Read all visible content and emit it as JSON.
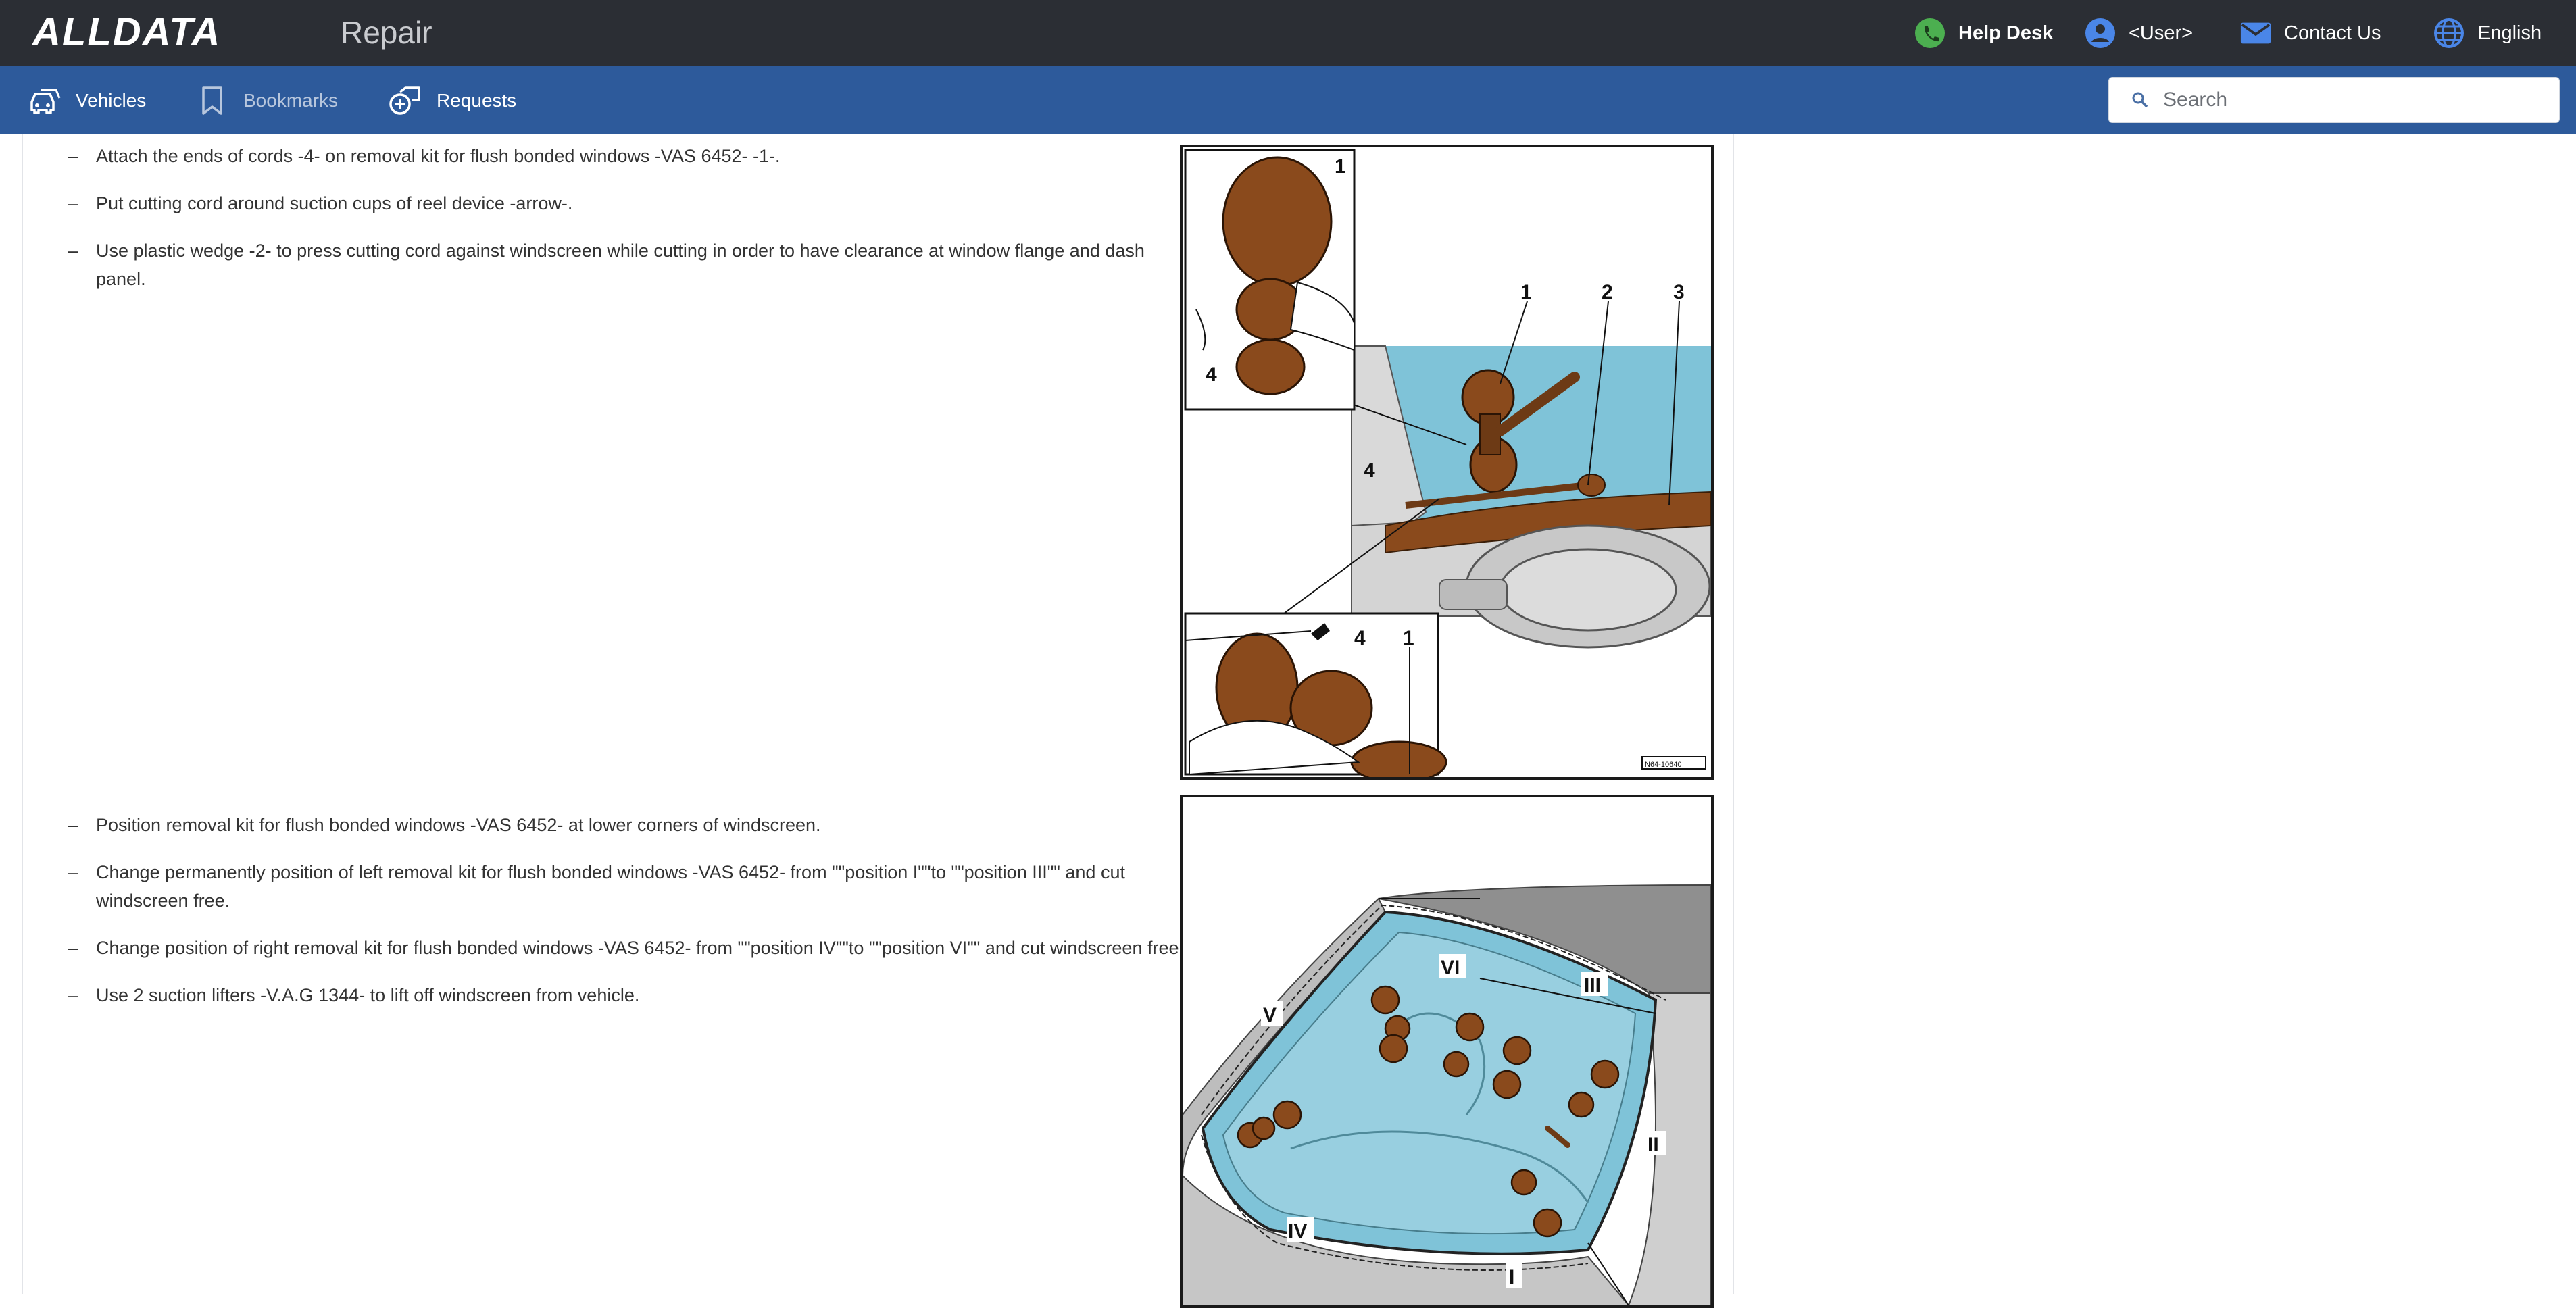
{
  "header": {
    "brand": "ALLDATA",
    "section": "Repair",
    "help_desk": "Help Desk",
    "user": "<User>",
    "contact": "Contact Us",
    "language": "English"
  },
  "nav": {
    "vehicles": "Vehicles",
    "bookmarks": "Bookmarks",
    "requests": "Requests"
  },
  "search": {
    "placeholder": "Search",
    "value": ""
  },
  "section1": {
    "steps": [
      "Attach the ends of cords -4- on removal kit for flush bonded windows -VAS 6452- -1-.",
      "Put cutting cord around suction cups of reel device -arrow-.",
      "Use plastic wedge -2- to press cutting cord against windscreen while cutting in order to have clearance at window flange and dash panel."
    ],
    "figure": {
      "labels": [
        "1",
        "1",
        "2",
        "3",
        "4",
        "4",
        "4",
        "1"
      ],
      "code": "N64-10640"
    }
  },
  "section2": {
    "steps": [
      "Position removal kit for flush bonded windows -VAS 6452- at lower corners of windscreen.",
      "Change permanently position of left removal kit for flush bonded windows -VAS 6452- from \"\"position I\"\"to \"\"position III\"\" and cut windscreen free.",
      "Change position of right removal kit for flush bonded windows -VAS 6452- from \"\"position IV\"\"to \"\"position VI\"\" and cut windscreen free.",
      "Use 2 suction lifters -V.A.G 1344- to lift off windscreen from vehicle."
    ],
    "figure": {
      "labels": [
        "V",
        "VI",
        "III",
        "II",
        "IV",
        "I"
      ]
    }
  },
  "colors": {
    "topbar": "#2b2e34",
    "navbar": "#2d5a9b",
    "glass": "#7fc3d8",
    "tool": "#8a4a1c"
  },
  "icons": [
    "phone-icon",
    "user-icon",
    "mail-icon",
    "globe-icon",
    "car-icon",
    "bookmark-icon",
    "requests-icon",
    "search-icon"
  ]
}
